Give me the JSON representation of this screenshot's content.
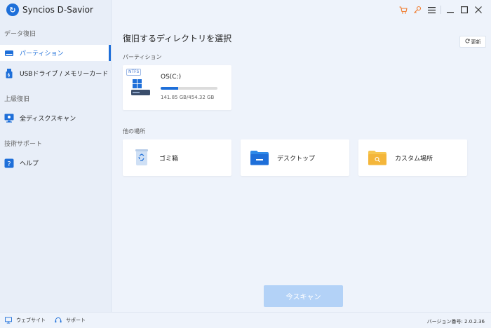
{
  "app": {
    "title": "Syncios D-Savior"
  },
  "topbar": {
    "icons": [
      "cart-icon",
      "key-icon",
      "menu-icon",
      "minimize-icon",
      "maximize-icon",
      "close-icon"
    ],
    "accent": "#f07a2a"
  },
  "sidebar": {
    "sections": [
      {
        "label": "データ復旧"
      },
      {
        "label": "上級復旧"
      },
      {
        "label": "技術サポート"
      }
    ],
    "items": [
      {
        "label": "パーティション",
        "icon": "drive-icon",
        "active": true
      },
      {
        "label": "USBドライブ / メモリーカード",
        "icon": "usb-icon",
        "active": false
      },
      {
        "label": "全ディスクスキャン",
        "icon": "monitor-icon",
        "active": false
      },
      {
        "label": "ヘルプ",
        "icon": "help-icon",
        "active": false
      }
    ]
  },
  "main": {
    "title": "復旧するディレクトリを選択",
    "refresh_label": "更新",
    "partition_section": "パーティション",
    "drive": {
      "fs": "NTFS",
      "name": "OS(C:)",
      "size": "141.85 GB/454.32 GB",
      "used_fraction": 0.31
    },
    "other_section": "他の場所",
    "locations": [
      {
        "label": "ゴミ箱",
        "icon": "recycle-bin-icon"
      },
      {
        "label": "デスクトップ",
        "icon": "desktop-folder-icon"
      },
      {
        "label": "カスタム場所",
        "icon": "custom-folder-icon"
      }
    ],
    "scan_label": "今スキャン"
  },
  "footer": {
    "website": "ウェブサイト",
    "support": "サポート",
    "version": "バージョン番号: 2.0.2.36"
  },
  "colors": {
    "accent": "#1e6fd9",
    "scan_button": "#b3d2f7",
    "background": "#eef3fb"
  }
}
